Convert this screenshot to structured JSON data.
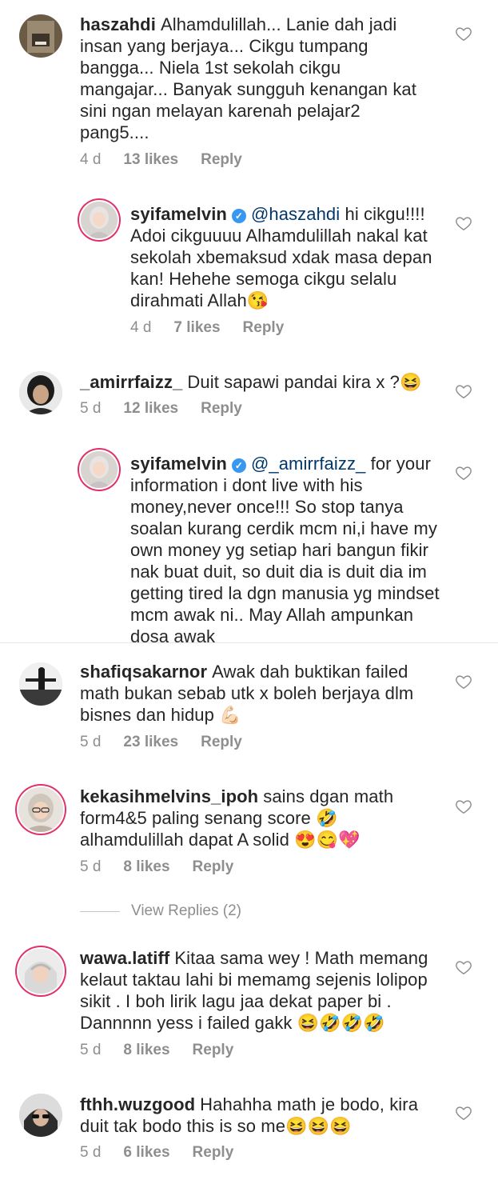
{
  "comments": [
    {
      "username": "haszahdi",
      "text": "Alhamdulillah... Lanie dah jadi insan yang berjaya... Cikgu tumpang bangga... Niela 1st sekolah cikgu mangajar... Banyak sungguh kenangan kat sini ngan melayan karenah pelajar2 pang5....",
      "time": "4 d",
      "likes": "13 likes",
      "reply": "Reply"
    },
    {
      "username": "syifamelvin",
      "mention": "@haszahdi",
      "text": "hi cikgu!!!! Adoi cikguuuu Alhamdulillah nakal kat sekolah xbemaksud xdak masa depan kan! Hehehe semoga cikgu selalu dirahmati Allah😘",
      "time": "4 d",
      "likes": "7 likes",
      "reply": "Reply"
    },
    {
      "username": "_amirrfaizz_",
      "text": "Duit sapawi pandai kira x ?😆",
      "time": "5 d",
      "likes": "12 likes",
      "reply": "Reply"
    },
    {
      "username": "syifamelvin",
      "mention": "@_amirrfaizz_",
      "text": "for your information i dont live with his money,never once!!! So stop tanya soalan kurang cerdik mcm ni,i have my own money yg setiap hari bangun fikir nak buat duit, so duit dia is duit dia im getting tired la dgn manusia yg mindset mcm awak ni.. May Allah ampunkan dosa awak"
    },
    {
      "username": "shafiqsakarnor",
      "text": "Awak dah buktikan failed math bukan sebab utk x boleh berjaya dlm bisnes dan hidup 💪🏻",
      "time": "5 d",
      "likes": "23 likes",
      "reply": "Reply"
    },
    {
      "username": "kekasihmelvins_ipoh",
      "text": "sains dgan math form4&5 paling senang score 🤣 alhamdulillah dapat A solid 😍😋💖",
      "time": "5 d",
      "likes": "8 likes",
      "reply": "Reply"
    },
    {
      "username": "wawa.latiff",
      "text": "Kitaa sama wey ! Math memang kelaut taktau lahi bi memamg sejenis lolipop sikit . I boh lirik lagu jaa dekat paper bi . Dannnnn yess i failed gakk 😆🤣🤣🤣",
      "time": "5 d",
      "likes": "8 likes",
      "reply": "Reply"
    },
    {
      "username": "fthh.wuzgood",
      "text": "Hahahha math je bodo, kira duit tak bodo this is so me😆😆😆",
      "time": "5 d",
      "likes": "6 likes",
      "reply": "Reply"
    }
  ],
  "view_replies": "View Replies (2)",
  "colors": {
    "text": "#262626",
    "meta": "#8e8e8e",
    "mention": "#00376b",
    "verified": "#3897f0"
  }
}
